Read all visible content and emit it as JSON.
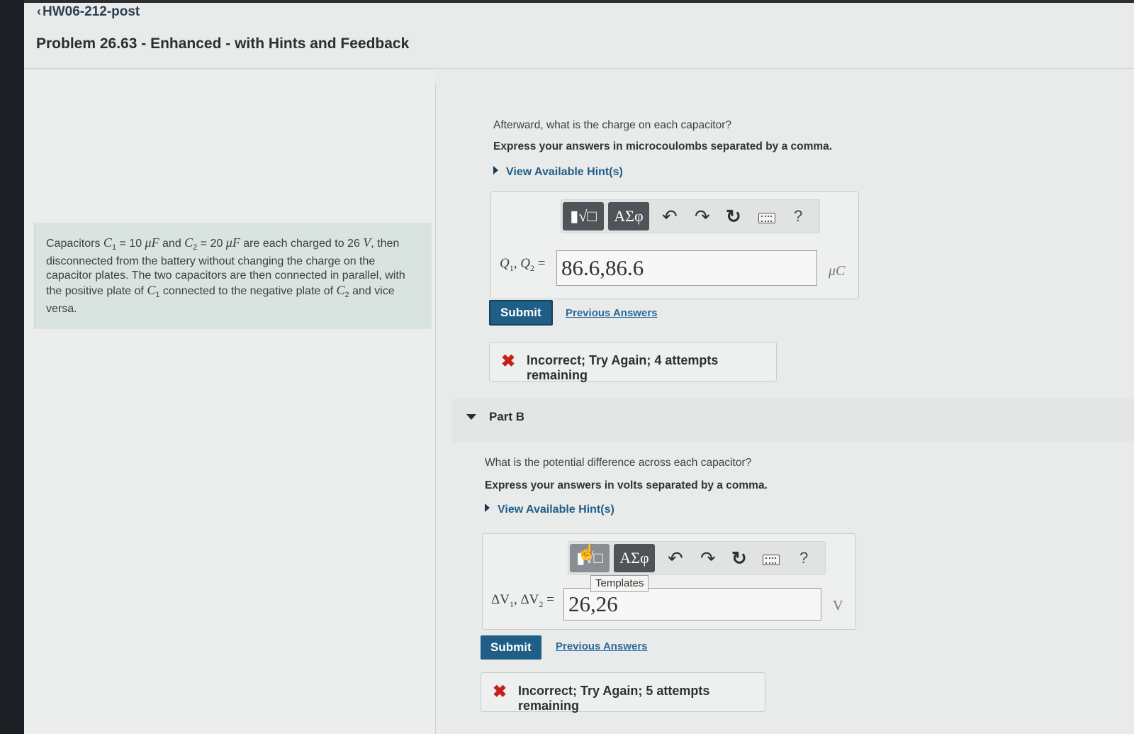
{
  "header": {
    "back_label": "HW06-212-post",
    "problem_title": "Problem 26.63 - Enhanced - with Hints and Feedback"
  },
  "problem": {
    "t1": "Capacitors ",
    "c1": "C",
    "c1_sub": "1",
    "t2": " = 10 ",
    "mu1": "μF",
    "t3": " and ",
    "c2": "C",
    "c2_sub": "2",
    "t4": " = 20 ",
    "mu2": "μF",
    "t5": " are each charged to 26 ",
    "v": "V",
    "t6": ", then disconnected from the battery without changing the charge on the capacitor plates. The two capacitors are then connected in parallel, with the positive plate of ",
    "c3": "C",
    "c3_sub": "1",
    "t7": " connected to the negative plate of ",
    "c4": "C",
    "c4_sub": "2",
    "t8": " and vice versa."
  },
  "part_a": {
    "question": "Afterward, what is the charge on each capacitor?",
    "instruction": "Express your answers in microcoulombs separated by a comma.",
    "hint_link": "View Available Hint(s)",
    "toolbar": {
      "templates_label": "▮√□",
      "symbols_label": "ΑΣφ",
      "undo_icon": "↶",
      "redo_icon": "↷",
      "reset_icon": "↻",
      "help_label": "?"
    },
    "var_q": "Q",
    "var_q1_sub": "1",
    "var_sep": ", ",
    "var_q2_sub": "2",
    "var_eq": " =",
    "answer_value": "86.6,86.6",
    "unit": "μC",
    "submit_label": "Submit",
    "previous_answers": "Previous Answers",
    "feedback_icon": "✖",
    "feedback_text": "Incorrect; Try Again; 4 attempts remaining"
  },
  "part_b": {
    "title": "Part B",
    "question": "What is the potential difference across each capacitor?",
    "instruction": "Express your answers in volts separated by a comma.",
    "hint_link": "View Available Hint(s)",
    "toolbar": {
      "templates_label": "▮√□",
      "symbols_label": "ΑΣφ",
      "undo_icon": "↶",
      "redo_icon": "↷",
      "reset_icon": "↻",
      "help_label": "?",
      "tooltip": "Templates"
    },
    "var_dv": "ΔV",
    "var_v1_sub": "1",
    "var_sep": ", ",
    "var_v2_sub": "2",
    "var_eq": " =",
    "answer_value": "26,26",
    "unit": "V",
    "submit_label": "Submit",
    "previous_answers": "Previous Answers",
    "feedback_icon": "✖",
    "feedback_text": "Incorrect; Try Again; 5 attempts remaining"
  },
  "colors": {
    "accent": "#1f5e86",
    "error": "#c6201c",
    "problem_box": "#d9e3df"
  },
  "icons": [
    "chevron-left-icon",
    "triangle-right-icon",
    "triangle-down-icon",
    "undo-icon",
    "redo-icon",
    "reset-icon",
    "keyboard-icon",
    "help-icon",
    "x-icon",
    "hand-cursor-icon"
  ]
}
